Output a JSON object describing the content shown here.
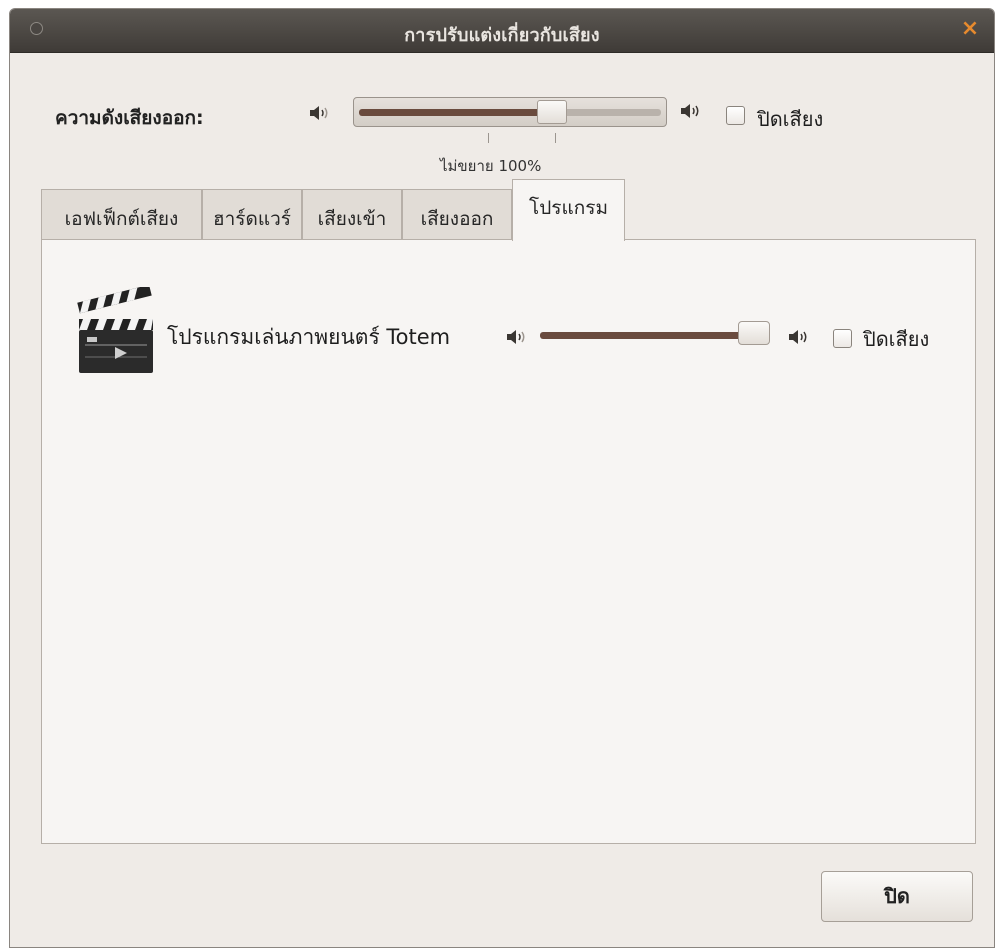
{
  "window": {
    "title": "การปรับแต่งเกี่ยวกับเสียง",
    "close_glyph": "×"
  },
  "output_volume": {
    "label": "ความดังเสียงออก:",
    "level_percent": 65,
    "tick_label": "ไม่ขยาย 100%",
    "mute_label": "ปิดเสียง",
    "muted": false
  },
  "tabs": [
    {
      "label": "เอฟเฟ็กต์เสียง",
      "active": false
    },
    {
      "label": "ฮาร์ดแวร์",
      "active": false
    },
    {
      "label": "เสียงเข้า",
      "active": false
    },
    {
      "label": "เสียงออก",
      "active": false
    },
    {
      "label": "โปรแกรม",
      "active": true
    }
  ],
  "applications": [
    {
      "name": "โปรแกรมเล่นภาพยนตร์ Totem",
      "icon": "clapperboard-icon",
      "level_percent": 100,
      "mute_label": "ปิดเสียง",
      "muted": false
    }
  ],
  "footer": {
    "close_button_label": "ปิด"
  },
  "colors": {
    "titlebar": "#4a4642",
    "close_accent": "#e68a2e",
    "slider_fill": "#6a4b3e",
    "window_bg": "#efebe7"
  }
}
